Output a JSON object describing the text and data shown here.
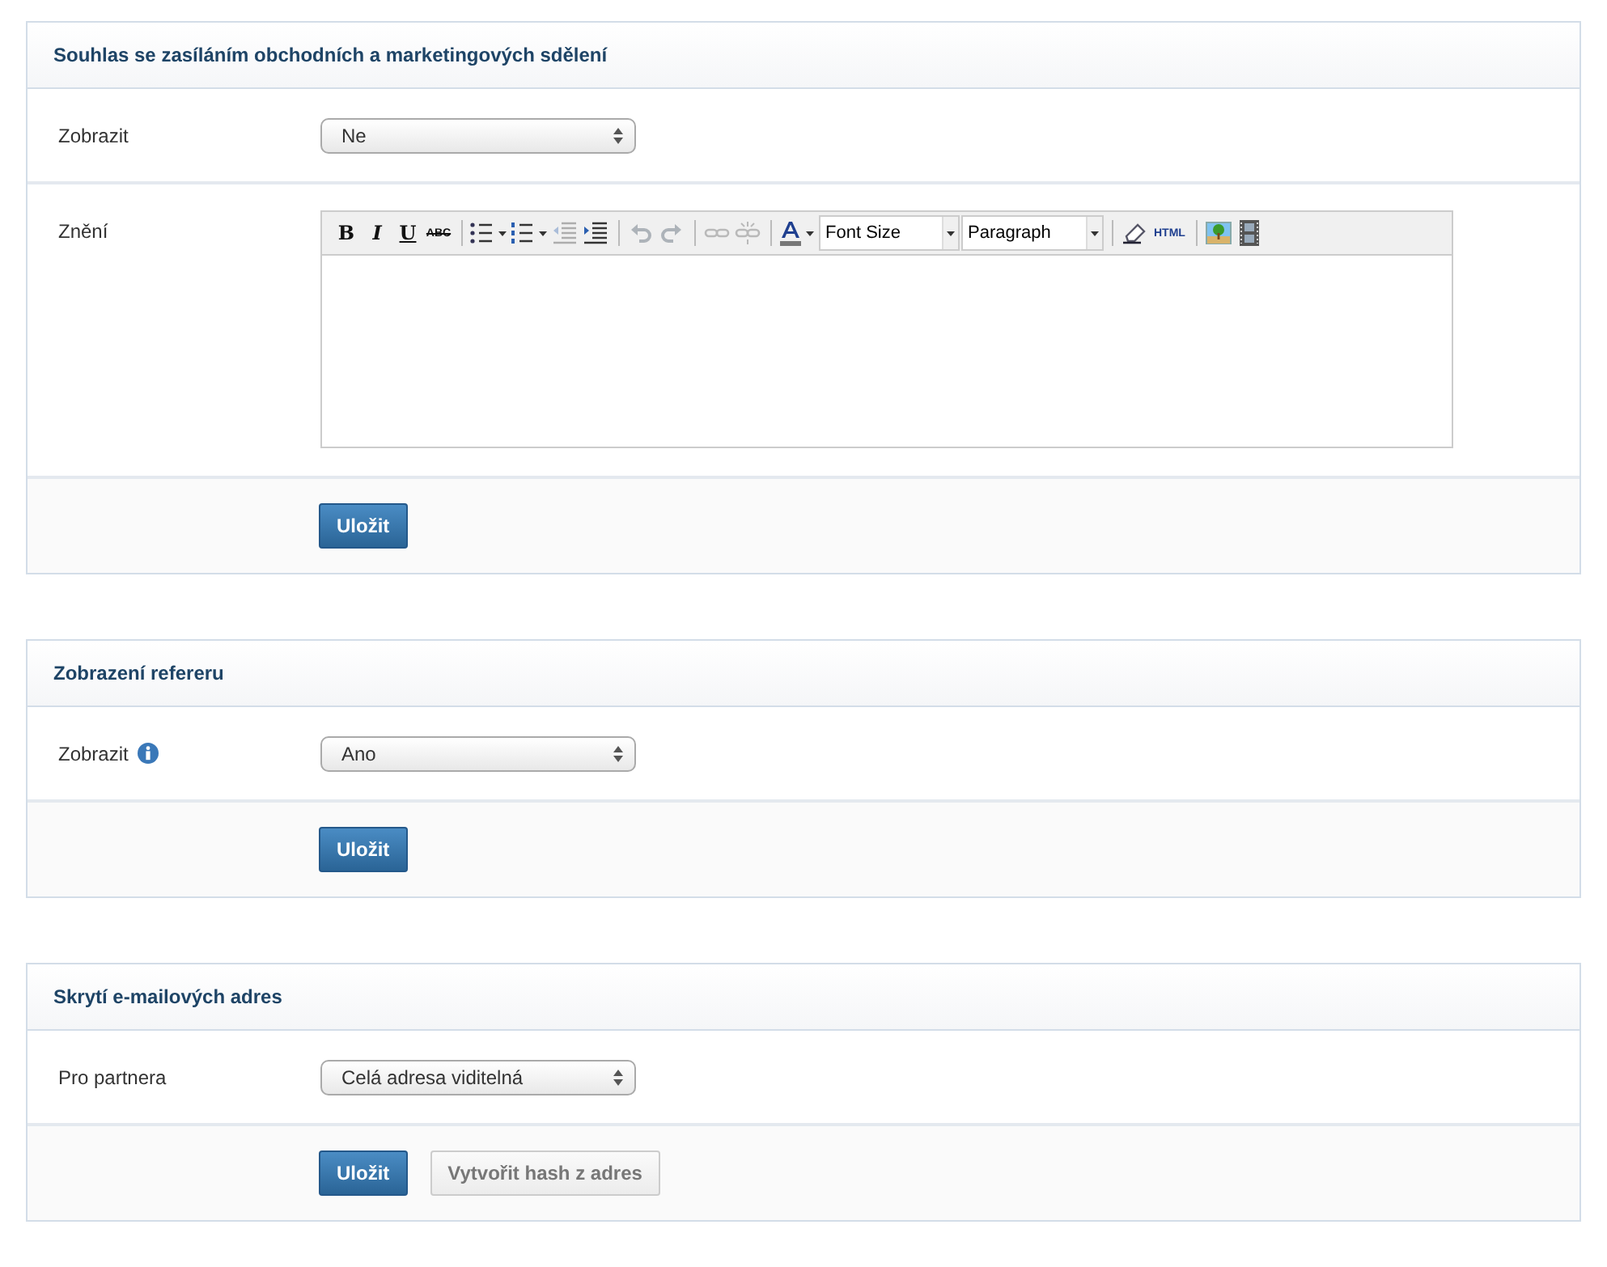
{
  "sections": [
    {
      "title": "Souhlas se zasíláním obchodních a marketingových sdělení",
      "fields": [
        {
          "kind": "select",
          "label": "Zobrazit",
          "info": false,
          "value": "Ne"
        },
        {
          "kind": "editor",
          "label": "Znění",
          "info": false,
          "toolbar": [
            {
              "kind": "bold",
              "label": "B",
              "disabled": false
            },
            {
              "kind": "italic",
              "label": "I",
              "disabled": false
            },
            {
              "kind": "underline",
              "label": "U",
              "disabled": false
            },
            {
              "kind": "strikethrough",
              "label": "ABC",
              "disabled": false
            },
            {
              "kind": "separator"
            },
            {
              "kind": "bullets",
              "disabled": false
            },
            {
              "kind": "numbering",
              "disabled": false
            },
            {
              "kind": "outdent",
              "disabled": true
            },
            {
              "kind": "indent",
              "disabled": false
            },
            {
              "kind": "separator"
            },
            {
              "kind": "undo",
              "disabled": true
            },
            {
              "kind": "redo",
              "disabled": true
            },
            {
              "kind": "separator"
            },
            {
              "kind": "link",
              "disabled": true
            },
            {
              "kind": "unlink",
              "disabled": true
            },
            {
              "kind": "separator"
            },
            {
              "kind": "forecolor",
              "disabled": false
            },
            {
              "kind": "dropdown",
              "label": "Font Size"
            },
            {
              "kind": "dropdown",
              "label": "Paragraph"
            },
            {
              "kind": "separator"
            },
            {
              "kind": "eraser",
              "disabled": false
            },
            {
              "kind": "html",
              "label": "HTML",
              "disabled": false
            },
            {
              "kind": "separator"
            },
            {
              "kind": "image",
              "disabled": false
            },
            {
              "kind": "media",
              "disabled": false
            }
          ]
        }
      ],
      "buttons": [
        {
          "kind": "primary",
          "label": "Uložit"
        }
      ]
    },
    {
      "title": "Zobrazení refereru",
      "fields": [
        {
          "kind": "select",
          "label": "Zobrazit",
          "info": true,
          "value": "Ano"
        }
      ],
      "buttons": [
        {
          "kind": "primary",
          "label": "Uložit"
        }
      ]
    },
    {
      "title": "Skrytí e-mailových adres",
      "fields": [
        {
          "kind": "select",
          "label": "Pro partnera",
          "info": false,
          "value": "Celá adresa viditelná"
        }
      ],
      "buttons": [
        {
          "kind": "primary",
          "label": "Uložit"
        },
        {
          "kind": "secondary",
          "label": "Vytvořit hash z adres"
        }
      ]
    }
  ]
}
